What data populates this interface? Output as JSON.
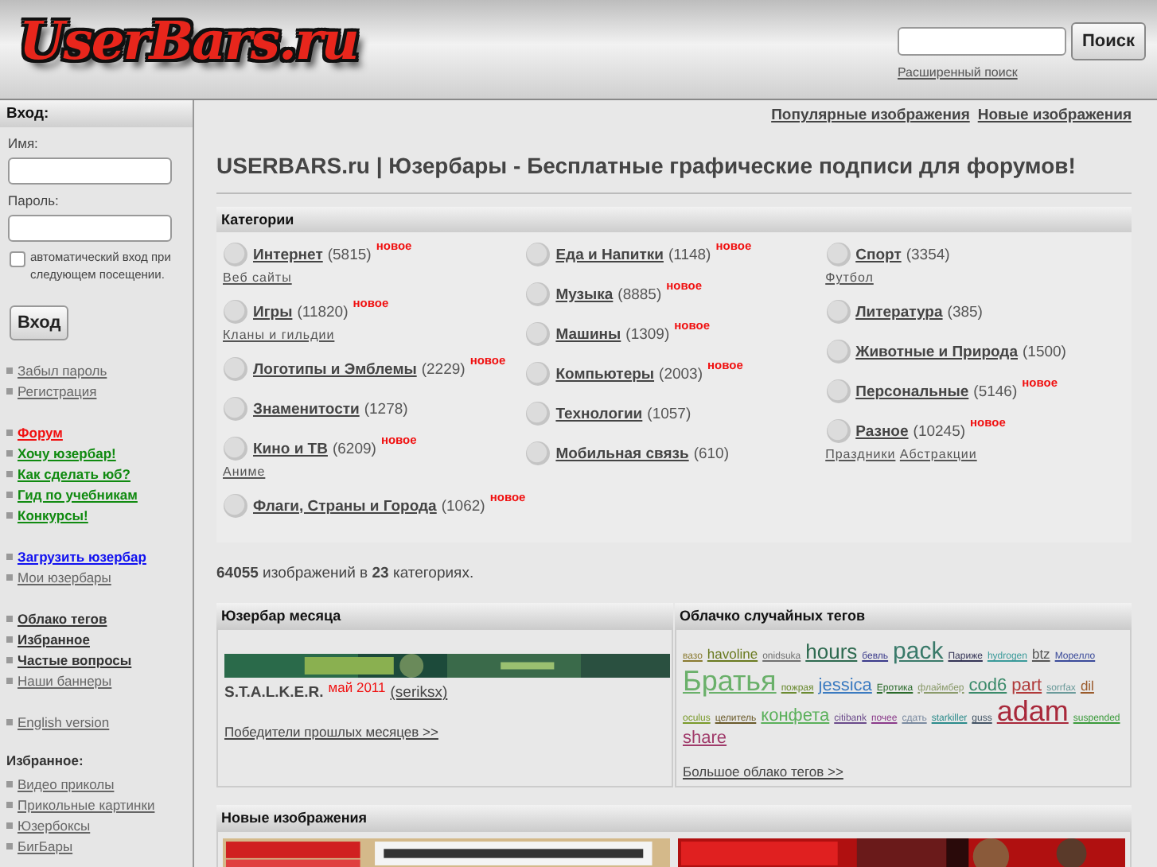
{
  "header": {
    "logo": "UserBars.ru",
    "search": {
      "button": "Поиск"
    },
    "advanced_search": "Расширенный поиск"
  },
  "sidebar": {
    "login_title": "Вход:",
    "name_label": "Имя:",
    "password_label": "Пароль:",
    "remember": {
      "label": "автоматический вход при следующем посещении.",
      "checked": false
    },
    "login_button": "Вход",
    "groups": [
      [
        {
          "text": "Забыл пароль",
          "kind": "plain"
        },
        {
          "text": "Регистрация",
          "kind": "plain"
        }
      ],
      [
        {
          "text": "Форум",
          "kind": "red"
        },
        {
          "text": "Хочу юзербар!",
          "kind": "green"
        },
        {
          "text": "Как сделать юб?",
          "kind": "green"
        },
        {
          "text": "Гид по учебникам",
          "kind": "green"
        },
        {
          "text": "Конкурсы!",
          "kind": "green"
        }
      ],
      [
        {
          "text": "Загрузить юзербар",
          "kind": "blue"
        },
        {
          "text": "Мои юзербары",
          "kind": "plain"
        }
      ],
      [
        {
          "text": "Облако тегов",
          "kind": "bold"
        },
        {
          "text": "Избранное",
          "kind": "bold"
        },
        {
          "text": "Частые вопросы",
          "kind": "bold"
        },
        {
          "text": "Наши баннеры",
          "kind": "plain"
        }
      ],
      [
        {
          "text": "English version",
          "kind": "plain"
        }
      ]
    ],
    "favorites_title": "Избранное:",
    "favorites": [
      "Видео приколы",
      "Прикольные картинки",
      "Юзербоксы",
      "БигБары"
    ]
  },
  "top_links": [
    "Популярные изображения",
    "Новые изображения"
  ],
  "title": "USERBARS.ru | Юзербары - Бесплатные графические подписи для форумов!",
  "categories": {
    "title": "Категории",
    "columns": [
      [
        {
          "name": "Интернет",
          "count": "(5815)",
          "badge": "новое",
          "subs": [
            "Веб сайты"
          ]
        },
        {
          "name": "Игры",
          "count": "(11820)",
          "badge": "новое",
          "subs": [
            "Кланы и гильдии"
          ]
        },
        {
          "name": "Логотипы и Эмблемы",
          "count": "(2229)",
          "badge": "новое"
        },
        {
          "name": "Знаменитости",
          "count": "(1278)"
        },
        {
          "name": "Кино и ТВ",
          "count": "(6209)",
          "badge": "новое",
          "subs": [
            "Аниме"
          ]
        },
        {
          "name": "Флаги, Страны и Города",
          "count": "(1062)",
          "badge": "новое"
        }
      ],
      [
        {
          "name": "Еда и Напитки",
          "count": "(1148)",
          "badge": "новое"
        },
        {
          "name": "Музыка",
          "count": "(8885)",
          "badge": "новое"
        },
        {
          "name": "Машины",
          "count": "(1309)",
          "badge": "новое"
        },
        {
          "name": "Компьютеры",
          "count": "(2003)",
          "badge": "новое"
        },
        {
          "name": "Технологии",
          "count": "(1057)"
        },
        {
          "name": "Мобильная связь",
          "count": "(610)"
        }
      ],
      [
        {
          "name": "Спорт",
          "count": "(3354)",
          "subs": [
            "Футбол"
          ]
        },
        {
          "name": "Литература",
          "count": "(385)"
        },
        {
          "name": "Животные и Природа",
          "count": "(1500)"
        },
        {
          "name": "Персональные",
          "count": "(5146)",
          "badge": "новое"
        },
        {
          "name": "Разное",
          "count": "(10245)",
          "badge": "новое",
          "subs": [
            "Праздники",
            "Абстракции"
          ]
        }
      ]
    ]
  },
  "stats": "**64055** изображений в **23** категориях.",
  "userbar_of_month": {
    "title": "Юзербар месяца",
    "name": "S.T.A.L.K.E.R.",
    "date": "май 2011",
    "author": "(seriksx)",
    "past_winners": "Победители прошлых месяцев >>"
  },
  "tag_cloud": {
    "title": "Облачко случайных тегов",
    "more": "Большое облако тегов >>",
    "tags": [
      {
        "text": "вазо",
        "kind": "tiny",
        "color": "#8a7a30"
      },
      {
        "text": "havoline",
        "kind": "small",
        "color": "#6a7a20"
      },
      {
        "text": "onidsuka",
        "kind": "tiny",
        "color": "#707070"
      },
      {
        "text": "hours",
        "kind": "large",
        "color": "#2e6a50"
      },
      {
        "text": "бевль",
        "kind": "tiny",
        "color": "#3a3a8a"
      },
      {
        "text": "pack",
        "kind": "larger",
        "color": "#3a7a6a"
      },
      {
        "text": "Париже",
        "kind": "tiny",
        "color": "#333355"
      },
      {
        "text": "hydrogen",
        "kind": "tiny",
        "color": "#3a9a9a"
      },
      {
        "text": "btz",
        "kind": "small",
        "color": "#555555"
      },
      {
        "text": "Морелло",
        "kind": "tiny",
        "color": "#3a4a9a"
      },
      {
        "text": "Братья",
        "kind": "huge",
        "color": "#6ab06a"
      },
      {
        "text": "пожрая",
        "kind": "tiny",
        "color": "#6a8a30"
      },
      {
        "text": "jessica",
        "kind": "medium",
        "color": "#3a7ac0"
      },
      {
        "text": "Еротика",
        "kind": "tiny",
        "color": "#2a6a2a"
      },
      {
        "text": "флаймбер",
        "kind": "tiny",
        "color": "#8a9a6a"
      },
      {
        "text": "cod6",
        "kind": "medium",
        "color": "#3a8a6a"
      },
      {
        "text": "part",
        "kind": "medium",
        "color": "#b03a3a"
      },
      {
        "text": "sorrfax",
        "kind": "tiny",
        "color": "#6a9a9a"
      },
      {
        "text": "dil",
        "kind": "small",
        "color": "#9a5a2a"
      },
      {
        "text": "oculus",
        "kind": "tiny",
        "color": "#7a9a2a"
      },
      {
        "text": "целитель",
        "kind": "tiny",
        "color": "#6a5a2a"
      },
      {
        "text": "конфета",
        "kind": "medium",
        "color": "#5ab05a"
      },
      {
        "text": "citibank",
        "kind": "tiny",
        "color": "#6a4a8a"
      },
      {
        "text": "почее",
        "kind": "tiny",
        "color": "#8a3a8a"
      },
      {
        "text": "сдать",
        "kind": "tiny",
        "color": "#7a8aa0"
      },
      {
        "text": "starkiller",
        "kind": "tiny",
        "color": "#2a8a8a"
      },
      {
        "text": "guss",
        "kind": "tiny",
        "color": "#445566"
      },
      {
        "text": "adam",
        "kind": "huge",
        "color": "#a8283a"
      },
      {
        "text": "suspended",
        "kind": "tiny",
        "color": "#3a9a3a"
      },
      {
        "text": "share",
        "kind": "medium",
        "color": "#a03a6a"
      }
    ]
  },
  "new_images": {
    "title": "Новые изображения"
  }
}
